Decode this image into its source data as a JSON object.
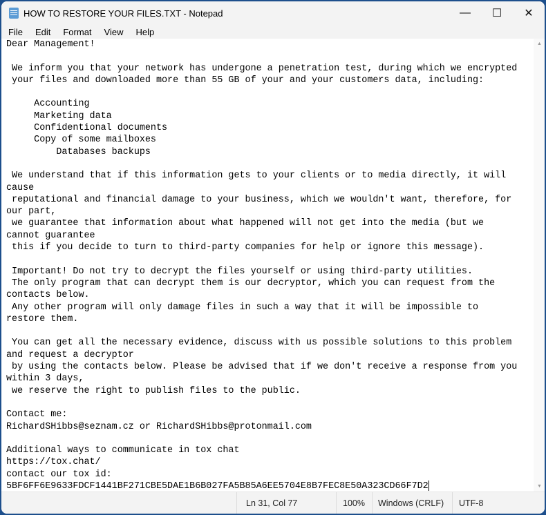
{
  "window": {
    "title": "HOW TO RESTORE YOUR FILES.TXT - Notepad",
    "minimize": "—",
    "maximize": "☐",
    "close": "✕"
  },
  "menu": [
    "File",
    "Edit",
    "Format",
    "View",
    "Help"
  ],
  "lines": [
    "Dear Management!",
    "",
    " We inform you that your network has undergone a penetration test, during which we encrypted",
    " your files and downloaded more than 55 GB of your and your customers data, including:",
    "",
    "     Accounting",
    "     Marketing data",
    "     Confidentional documents",
    "     Copy of some mailboxes",
    "         Databases backups",
    "",
    " We understand that if this information gets to your clients or to media directly, it will",
    "cause",
    " reputational and financial damage to your business, which we wouldn't want, therefore, for",
    "our part,",
    " we guarantee that information about what happened will not get into the media (but we",
    "cannot guarantee",
    " this if you decide to turn to third-party companies for help or ignore this message).",
    "",
    " Important! Do not try to decrypt the files yourself or using third-party utilities.",
    " The only program that can decrypt them is our decryptor, which you can request from the",
    "contacts below.",
    " Any other program will only damage files in such a way that it will be impossible to",
    "restore them.",
    "",
    " You can get all the necessary evidence, discuss with us possible solutions to this problem",
    "and request a decryptor",
    " by using the contacts below. Please be advised that if we don't receive a response from you",
    "within 3 days,",
    " we reserve the right to publish files to the public.",
    "",
    "Contact me:",
    "RichardSHibbs@seznam.cz or RichardSHibbs@protonmail.com",
    "",
    "Additional ways to communicate in tox chat",
    "https://tox.chat/",
    "contact our tox id:",
    "5BF6FF6E9633FDCF1441BF271CBE5DAE1B6B027FA5B85A6EE5704E8B7FEC8E50A323CD66F7D2"
  ],
  "status": {
    "position": "Ln 31, Col 77",
    "zoom": "100%",
    "line_ending": "Windows (CRLF)",
    "encoding": "UTF-8"
  }
}
